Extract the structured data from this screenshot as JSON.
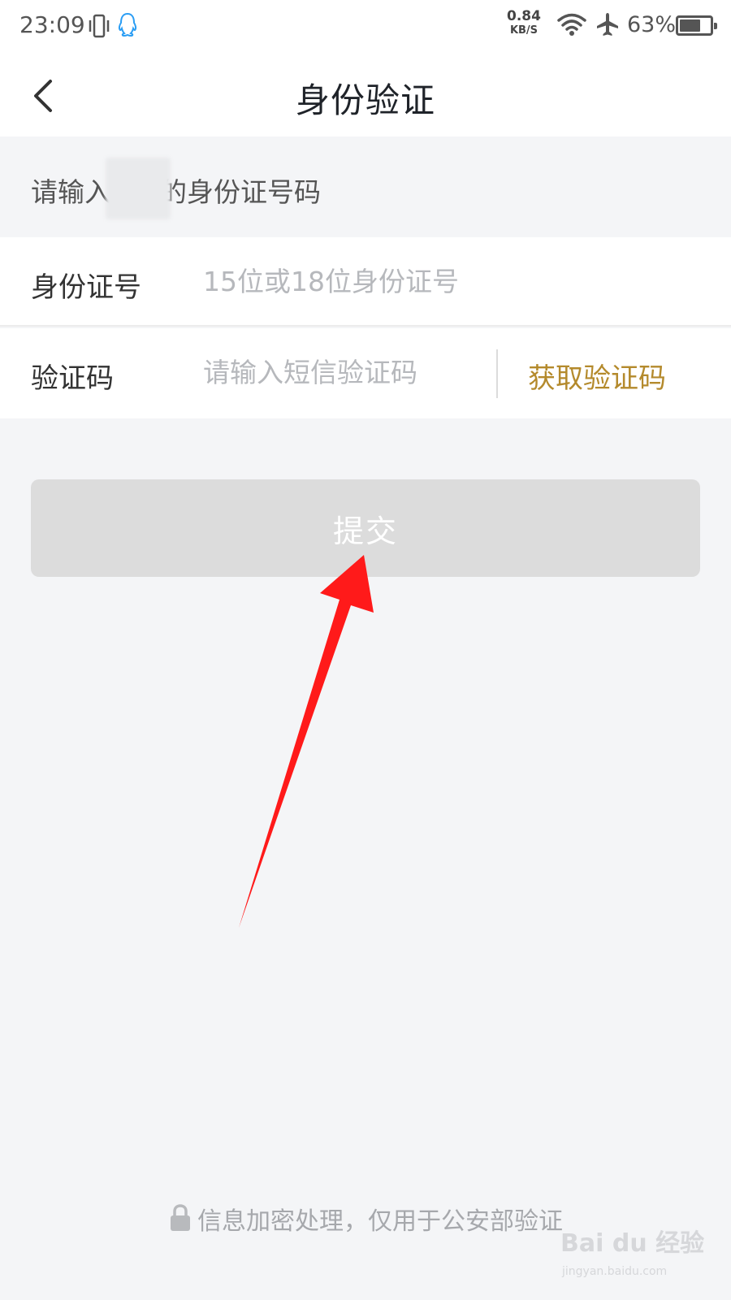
{
  "status_bar": {
    "time": "23:09",
    "net_speed_value": "0.84",
    "net_speed_unit": "KB/S",
    "battery_percent": "63%",
    "icons": [
      "vibrate-icon",
      "qq-icon",
      "wifi-icon",
      "airplane-icon",
      "battery-icon"
    ]
  },
  "nav": {
    "title": "身份验证",
    "back_icon": "chevron-left-icon"
  },
  "hint": {
    "prefix": "请输入",
    "suffix": "的身份证号码"
  },
  "form": {
    "id_label": "身份证号",
    "id_placeholder": "15位或18位身份证号",
    "code_label": "验证码",
    "code_placeholder": "请输入短信验证码",
    "get_code_label": "获取验证码"
  },
  "submit": {
    "label": "提交"
  },
  "footer": {
    "note": "信息加密处理，仅用于公安部验证"
  },
  "watermark": {
    "text": "Bai du 经验",
    "url": "jingyan.baidu.com"
  },
  "colors": {
    "accent_gold": "#b48a2c",
    "submit_disabled": "#dcdcdc",
    "background": "#f4f5f7",
    "annotation_arrow": "#ff1a1a"
  }
}
